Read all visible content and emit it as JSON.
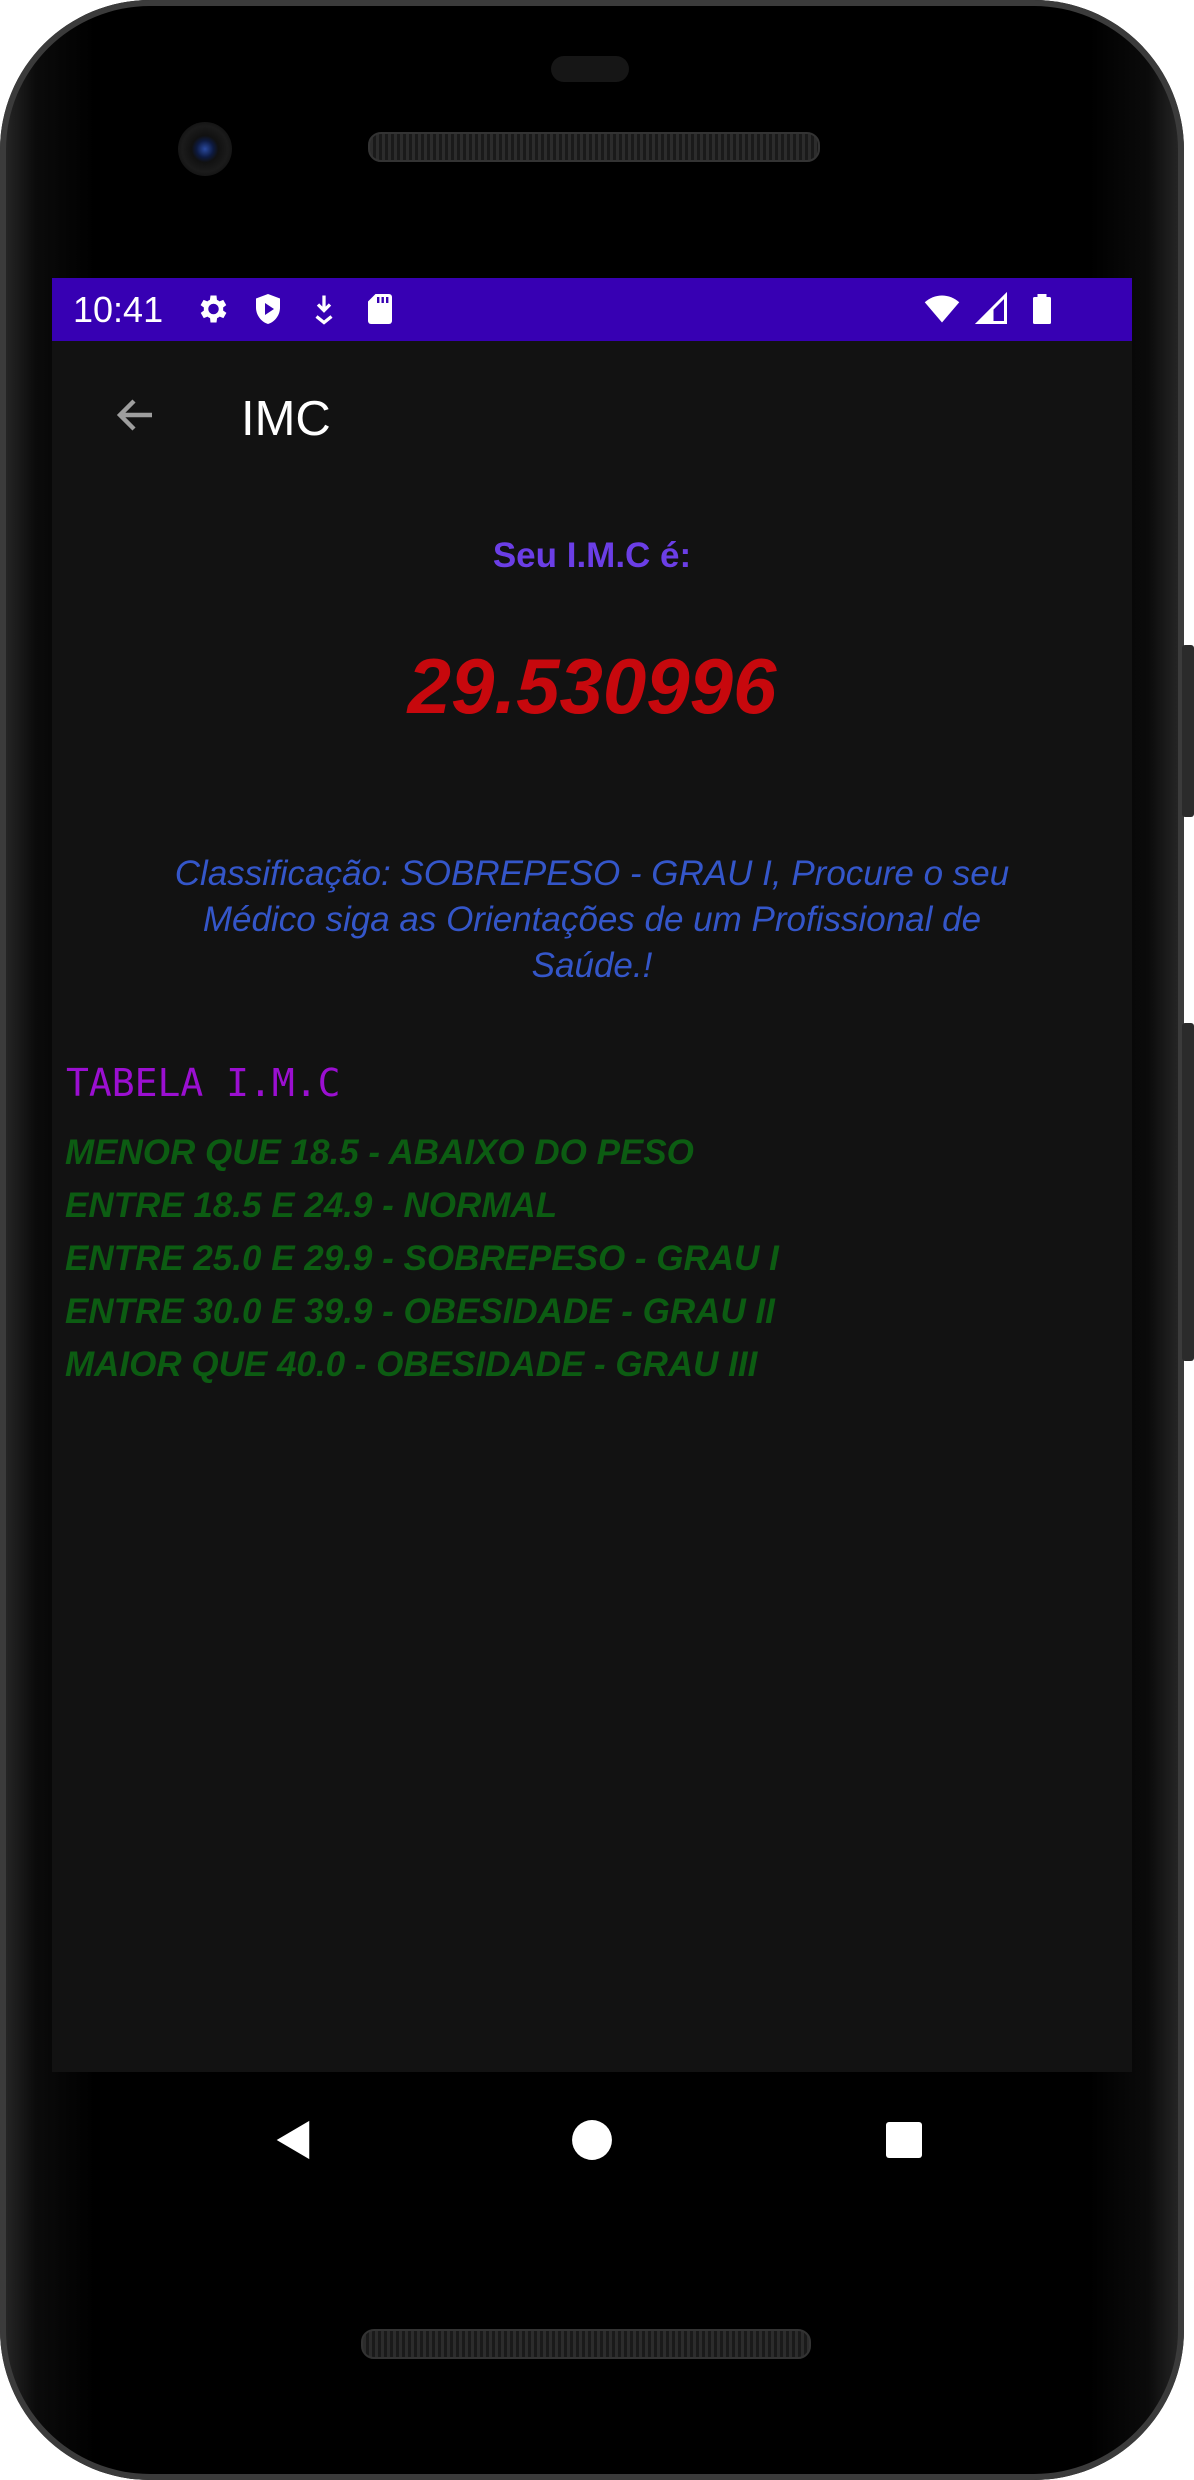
{
  "status_bar": {
    "time": "10:41",
    "left_icons": [
      "gear-icon",
      "shield-play-icon",
      "download-icon",
      "sd-card-icon"
    ],
    "right_icons": [
      "wifi-icon",
      "signal-icon",
      "battery-icon"
    ],
    "color": "#3700b3"
  },
  "app_bar": {
    "title": "IMC",
    "back_icon": "arrow-back-icon"
  },
  "result": {
    "label": "Seu I.M.C é:",
    "value": "29.530996",
    "classification": "Classificação: SOBREPESO - GRAU I, Procure o seu Médico siga as Orientações de um Profissional de Saúde.!"
  },
  "table": {
    "title": "TABELA I.M.C",
    "rows": [
      "MENOR QUE 18.5 - ABAIXO DO PESO",
      "ENTRE 18.5 E 24.9 - NORMAL",
      "ENTRE 25.0 E 29.9 - SOBREPESO - GRAU I",
      "ENTRE 30.0 E 39.9 - OBESIDADE - GRAU II",
      "MAIOR QUE 40.0 - OBESIDADE - GRAU III"
    ]
  },
  "nav_bar": {
    "buttons": [
      "nav-back-icon",
      "nav-home-icon",
      "nav-recents-icon"
    ]
  },
  "colors": {
    "background": "#121212",
    "result_label": "#6b3ee6",
    "bmi_value": "#c7080d",
    "classification": "#3456c9",
    "table_title": "#9b0fd1",
    "table_rows": "#0c5c12"
  }
}
